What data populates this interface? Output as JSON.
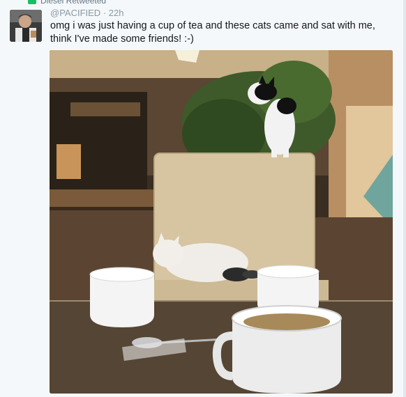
{
  "retweet": {
    "label": "Diesel Retweeted"
  },
  "tweet": {
    "handle": "@PACIFIED",
    "separator": "·",
    "time": "22h",
    "text": "omg i was just having a cup of tea and these cats came and sat with me, think I've made some friends! :-)"
  },
  "icons": {
    "retweet": "retweet-icon",
    "avatar": "avatar-image"
  },
  "colors": {
    "retweet_green": "#17bf63",
    "meta_grey": "#8899a6",
    "text": "#14171a"
  }
}
